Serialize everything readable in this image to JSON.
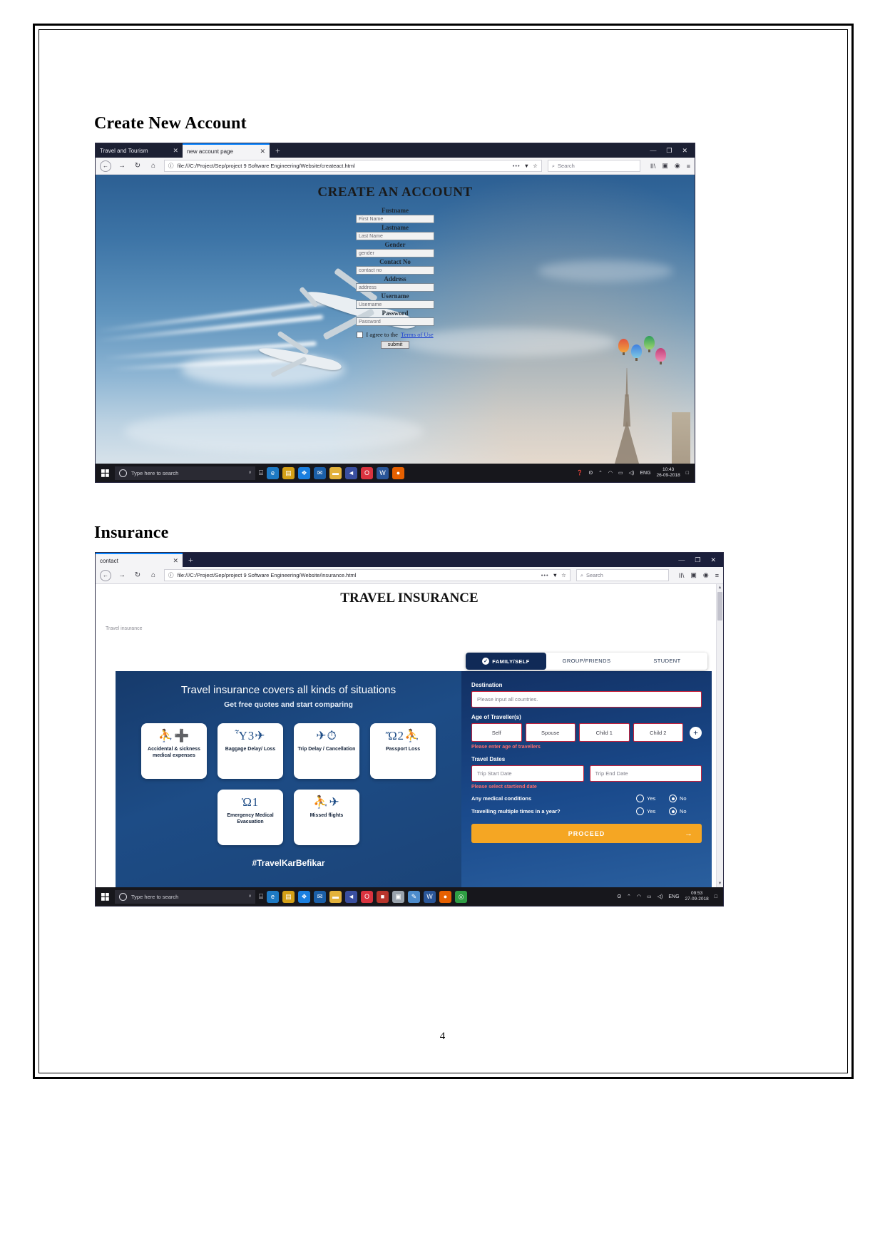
{
  "document": {
    "page_number": "4",
    "sections": [
      {
        "heading": "Create New Account"
      },
      {
        "heading": "Insurance"
      }
    ]
  },
  "shot1": {
    "browser": {
      "tabs": [
        {
          "title": "Travel and Tourism",
          "active": false,
          "close": "✕"
        },
        {
          "title": "new account page",
          "active": true,
          "close": "✕"
        }
      ],
      "new_tab_label": "+",
      "window_controls": {
        "minimize": "—",
        "maximize": "❐",
        "close": "✕"
      },
      "nav": {
        "back": "←",
        "forward": "→",
        "reload": "↻",
        "home": "⌂",
        "info_icon": "ⓘ",
        "url": "file:///C:/Project/Sep/project 9 Software Engineering/Website/createact.html",
        "page_actions": "•••",
        "shield_icon": "▼",
        "bookmark_icon": "☆",
        "search_icon": "⌕",
        "search_placeholder": "Search",
        "library_icon": "II\\",
        "sidebar_icon": "▣",
        "account_icon": "◉",
        "menu_icon": "≡"
      }
    },
    "page": {
      "title": "CREATE AN ACCOUNT",
      "fields": [
        {
          "label": "Fustname",
          "placeholder": "First Name"
        },
        {
          "label": "Lastname",
          "placeholder": "Last Name"
        },
        {
          "label": "Gender",
          "placeholder": "gender"
        },
        {
          "label": "Contact No",
          "placeholder": "contact no"
        },
        {
          "label": "Address",
          "placeholder": "address"
        },
        {
          "label": "Username",
          "placeholder": "Username"
        },
        {
          "label": "Password",
          "placeholder": "Password"
        }
      ],
      "agree_text": "I agree to the",
      "terms_link": "Terms of Use",
      "submit_label": "submit"
    },
    "taskbar": {
      "search_placeholder": "Type here to search",
      "mic_icon": "ᵛ",
      "task_view_icon": "⌸",
      "apps": [
        {
          "name": "edge-icon",
          "glyph": "e",
          "color": "#1e7ac4"
        },
        {
          "name": "store-icon",
          "glyph": "▤",
          "color": "#d4a017"
        },
        {
          "name": "dropbox-icon",
          "glyph": "❖",
          "color": "#1a7fe0"
        },
        {
          "name": "mail-icon",
          "glyph": "✉",
          "color": "#1b5fa8"
        },
        {
          "name": "explorer-icon",
          "glyph": "▬",
          "color": "#e3b23c"
        },
        {
          "name": "vlc-icon",
          "glyph": "◄",
          "color": "#3a4fa0"
        },
        {
          "name": "opera-icon",
          "glyph": "O",
          "color": "#d9333f"
        },
        {
          "name": "word-icon",
          "glyph": "W",
          "color": "#2a5699"
        },
        {
          "name": "firefox-icon",
          "glyph": "●",
          "color": "#e66000"
        }
      ],
      "tray": {
        "help_icon": "❓",
        "people_icon": "ʘ",
        "chevron_icon": "⌃",
        "wifi_icon": "◠",
        "battery_icon": "▭",
        "volume_icon": "◁)",
        "language": "ENG",
        "time": "10:43",
        "date": "26-09-2018",
        "notification_icon": "□"
      }
    }
  },
  "shot2": {
    "browser": {
      "tabs": [
        {
          "title": "contact",
          "active": true,
          "close": "✕"
        }
      ],
      "new_tab_label": "+",
      "window_controls": {
        "minimize": "—",
        "maximize": "❐",
        "close": "✕"
      },
      "nav": {
        "back": "←",
        "forward": "→",
        "reload": "↻",
        "home": "⌂",
        "info_icon": "ⓘ",
        "url": "file:///C:/Project/Sep/project 9 Software Engineering/Website/insurance.html",
        "page_actions": "•••",
        "shield_icon": "▼",
        "bookmark_icon": "☆",
        "search_icon": "⌕",
        "search_placeholder": "Search",
        "library_icon": "II\\",
        "sidebar_icon": "▣",
        "account_icon": "◉",
        "menu_icon": "≡"
      }
    },
    "page": {
      "title": "TRAVEL INSURANCE",
      "breadcrumb": "Travel insurance",
      "promo": {
        "headline": "Travel insurance covers all kinds of situations",
        "subhead": "Get free quotes and start comparing",
        "cards": [
          {
            "caption": "Accidental & sickness medical expenses",
            "icon": "running-person-plus-icon",
            "glyphs": "⛹➕"
          },
          {
            "caption": "Baggage Delay/ Loss",
            "icon": "suitcase-clock-icon",
            "glyphs": "Ὗ3✈"
          },
          {
            "caption": "Trip Delay / Cancellation",
            "icon": "plane-clock-icon",
            "glyphs": "✈⏱"
          },
          {
            "caption": "Passport Loss",
            "icon": "passport-running-icon",
            "glyphs": "Ὤ2⛹"
          },
          {
            "caption": "Emergency Medical Evacuation",
            "icon": "ambulance-icon",
            "glyphs": "Ὡ1"
          },
          {
            "caption": "Missed flights",
            "icon": "missed-flight-icon",
            "glyphs": "⛹✈"
          }
        ],
        "hashtag": "#TravelKarBefikar"
      },
      "quote_form": {
        "segments": [
          {
            "label": "FAMILY/SELF",
            "active": true,
            "check": "✓"
          },
          {
            "label": "GROUP/FRIENDS",
            "active": false
          },
          {
            "label": "STUDENT",
            "active": false
          }
        ],
        "destination_label": "Destination",
        "destination_placeholder": "Please input all countries.",
        "age_label": "Age of Traveller(s)",
        "age_boxes": [
          "Self",
          "Spouse",
          "Child 1",
          "Child 2"
        ],
        "add_traveller_icon": "+",
        "age_error": "Please enter age of travellers",
        "dates_label": "Travel Dates",
        "start_date_placeholder": "Trip Start Date",
        "end_date_placeholder": "Trip End Date",
        "dates_error": "Please select start/end date",
        "questions": [
          {
            "label": "Any medical conditions",
            "options": [
              "Yes",
              "No"
            ],
            "selected": "No"
          },
          {
            "label": "Travelling multiple times in a year?",
            "options": [
              "Yes",
              "No"
            ],
            "selected": "No"
          }
        ],
        "proceed_label": "PROCEED",
        "proceed_arrow": "→"
      }
    },
    "taskbar": {
      "search_placeholder": "Type here to search",
      "mic_icon": "ᵛ",
      "task_view_icon": "⌸",
      "apps": [
        {
          "name": "edge-icon",
          "glyph": "e",
          "color": "#1e7ac4"
        },
        {
          "name": "store-icon",
          "glyph": "▤",
          "color": "#d4a017"
        },
        {
          "name": "dropbox-icon",
          "glyph": "❖",
          "color": "#1a7fe0"
        },
        {
          "name": "mail-icon",
          "glyph": "✉",
          "color": "#1b5fa8"
        },
        {
          "name": "explorer-icon",
          "glyph": "▬",
          "color": "#e3b23c"
        },
        {
          "name": "vlc-icon",
          "glyph": "◄",
          "color": "#3a4fa0"
        },
        {
          "name": "opera-icon",
          "glyph": "O",
          "color": "#d9333f"
        },
        {
          "name": "pdf-icon",
          "glyph": "■",
          "color": "#b8352c"
        },
        {
          "name": "photos-icon",
          "glyph": "▣",
          "color": "#9aa3ad"
        },
        {
          "name": "paint-icon",
          "glyph": "✎",
          "color": "#4d8ccd"
        },
        {
          "name": "word-icon",
          "glyph": "W",
          "color": "#2a5699"
        },
        {
          "name": "firefox-icon",
          "glyph": "●",
          "color": "#e66000"
        },
        {
          "name": "chrome-icon",
          "glyph": "◎",
          "color": "#2f9e44"
        }
      ],
      "tray": {
        "people_icon": "ʘ",
        "chevron_icon": "⌃",
        "wifi_icon": "◠",
        "battery_icon": "▭",
        "volume_icon": "◁)",
        "language": "ENG",
        "time": "09:53",
        "date": "27-09-2018",
        "notification_icon": "□"
      }
    }
  }
}
